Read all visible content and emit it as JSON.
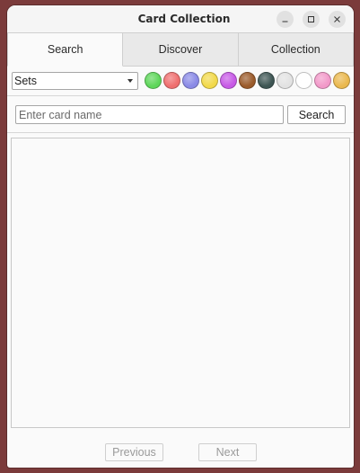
{
  "window": {
    "title": "Card Collection"
  },
  "tabs": [
    {
      "label": "Search",
      "active": true
    },
    {
      "label": "Discover",
      "active": false
    },
    {
      "label": "Collection",
      "active": false
    }
  ],
  "filters": {
    "set_select_value": "Sets",
    "color_swatches": [
      {
        "name": "green",
        "color": "#5ed65a"
      },
      {
        "name": "red",
        "color": "#ef6f6f"
      },
      {
        "name": "blue",
        "color": "#8a8ae6"
      },
      {
        "name": "yellow",
        "color": "#f2d94a"
      },
      {
        "name": "purple",
        "color": "#c75ae6"
      },
      {
        "name": "brown",
        "color": "#9a5a2a"
      },
      {
        "name": "dark-teal",
        "color": "#3d5553"
      },
      {
        "name": "light-gray",
        "color": "#e2e2e2"
      },
      {
        "name": "white",
        "color": "#ffffff"
      },
      {
        "name": "pink",
        "color": "#f299c9"
      },
      {
        "name": "gold",
        "color": "#eab84e"
      }
    ]
  },
  "search": {
    "placeholder": "Enter card name",
    "value": "",
    "button_label": "Search"
  },
  "pagination": {
    "previous_label": "Previous",
    "next_label": "Next"
  }
}
